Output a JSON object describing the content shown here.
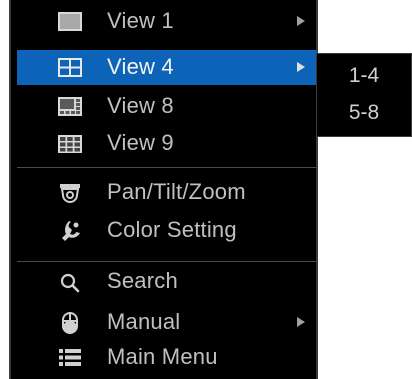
{
  "menu": {
    "items": [
      {
        "label": "View 1",
        "icon": "single-view-icon",
        "has_submenu": true,
        "selected": false
      },
      {
        "label": "View 4",
        "icon": "quad-view-icon",
        "has_submenu": true,
        "selected": true
      },
      {
        "label": "View 8",
        "icon": "eight-view-icon",
        "has_submenu": false,
        "selected": false
      },
      {
        "label": "View 9",
        "icon": "nine-view-icon",
        "has_submenu": false,
        "selected": false
      },
      {
        "label": "Pan/Tilt/Zoom",
        "icon": "ptz-camera-icon",
        "has_submenu": false,
        "selected": false
      },
      {
        "label": "Color Setting",
        "icon": "color-setting-icon",
        "has_submenu": false,
        "selected": false
      },
      {
        "label": "Search",
        "icon": "search-icon",
        "has_submenu": false,
        "selected": false
      },
      {
        "label": "Manual",
        "icon": "mouse-icon",
        "has_submenu": true,
        "selected": false
      },
      {
        "label": "Main Menu",
        "icon": "list-menu-icon",
        "has_submenu": false,
        "selected": false
      }
    ]
  },
  "submenu": {
    "items": [
      {
        "label": "1-4"
      },
      {
        "label": "5-8"
      }
    ]
  },
  "colors": {
    "background": "#000000",
    "highlight": "#0d63b8",
    "text": "#c0c0c0",
    "separator": "#4a4a4a"
  }
}
